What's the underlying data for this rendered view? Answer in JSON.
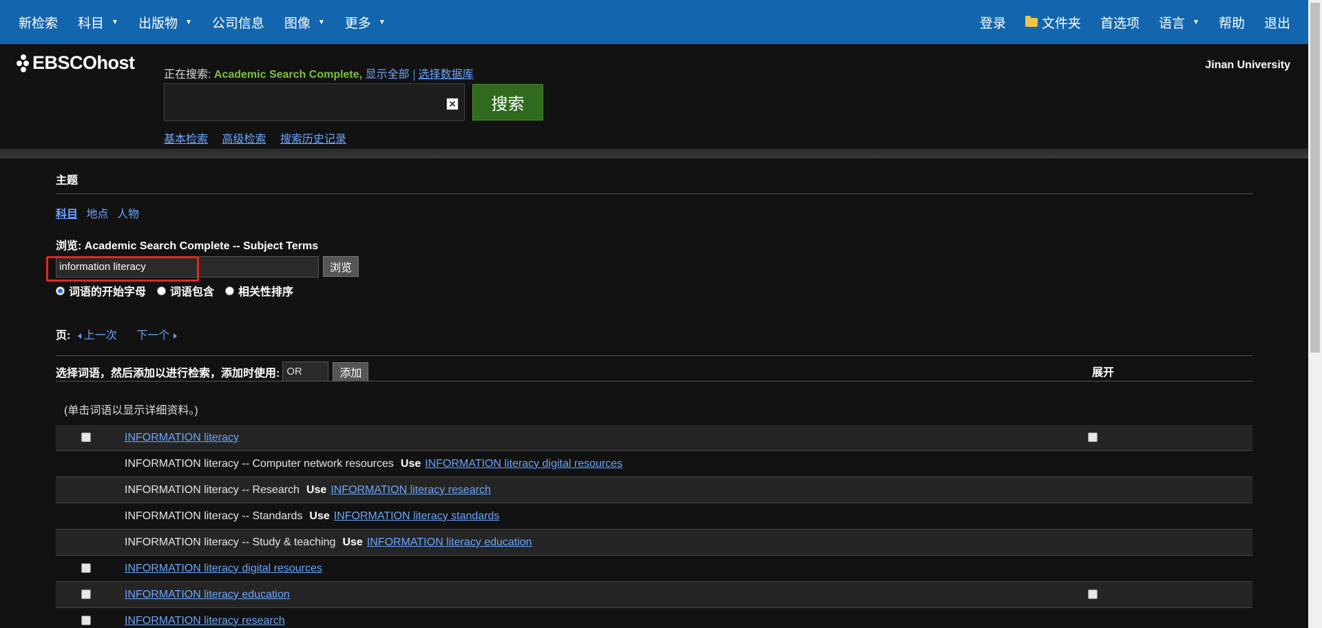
{
  "topnav": {
    "left": [
      {
        "label": "新检索",
        "caret": false
      },
      {
        "label": "科目",
        "caret": true
      },
      {
        "label": "出版物",
        "caret": true
      },
      {
        "label": "公司信息",
        "caret": false
      },
      {
        "label": "图像",
        "caret": true
      },
      {
        "label": "更多",
        "caret": true
      }
    ],
    "right": {
      "login": "登录",
      "folder": "文件夹",
      "preferences": "首选项",
      "language": "语言",
      "help": "帮助",
      "logout": "退出"
    },
    "caret_glyph": "▼"
  },
  "header": {
    "logo": "EBSCOhost",
    "searching_label": "正在搜索:",
    "database": "Academic Search Complete,",
    "show_all": "显示全部",
    "choose_db": "选择数据库",
    "search_value": "",
    "clear_glyph": "✕",
    "search_button": "搜索",
    "links": {
      "basic": "基本检索",
      "advanced": "高级检索",
      "history": "搜索历史记录"
    },
    "org": "Jinan University"
  },
  "main": {
    "section_title": "主题",
    "tabs": [
      {
        "label": "科目",
        "active": true
      },
      {
        "label": "地点",
        "active": false
      },
      {
        "label": "人物",
        "active": false
      }
    ],
    "browse_title": "浏览: Academic Search Complete -- Subject Terms",
    "browse_value": "information literacy",
    "browse_button": "浏览",
    "radios": [
      {
        "label": "词语的开始字母",
        "checked": true
      },
      {
        "label": "词语包含",
        "checked": false
      },
      {
        "label": "相关性排序",
        "checked": false
      }
    ],
    "pager": {
      "label": "页:",
      "prev": "上一次",
      "next": "下一个"
    },
    "select_label": "选择词语，然后添加以进行检索，添加时使用:",
    "operator": "OR",
    "add_button": "添加",
    "expand_header": "展开",
    "hint": "(单击词语以显示详细资料。)",
    "rows": {
      "r0": {
        "term": "INFORMATION literacy"
      },
      "r1": {
        "term": "INFORMATION literacy -- Computer network resources",
        "use": "Use",
        "target": "INFORMATION literacy digital resources"
      },
      "r2": {
        "term": "INFORMATION literacy -- Research",
        "use": "Use",
        "target": "INFORMATION literacy research"
      },
      "r3": {
        "term": "INFORMATION literacy -- Standards",
        "use": "Use",
        "target": "INFORMATION literacy standards"
      },
      "r4": {
        "term": "INFORMATION literacy -- Study & teaching",
        "use": "Use",
        "target": "INFORMATION literacy education"
      },
      "r5": {
        "term": "INFORMATION literacy digital resources"
      },
      "r6": {
        "term": "INFORMATION literacy education"
      },
      "r7": {
        "term": "INFORMATION literacy research"
      }
    }
  }
}
